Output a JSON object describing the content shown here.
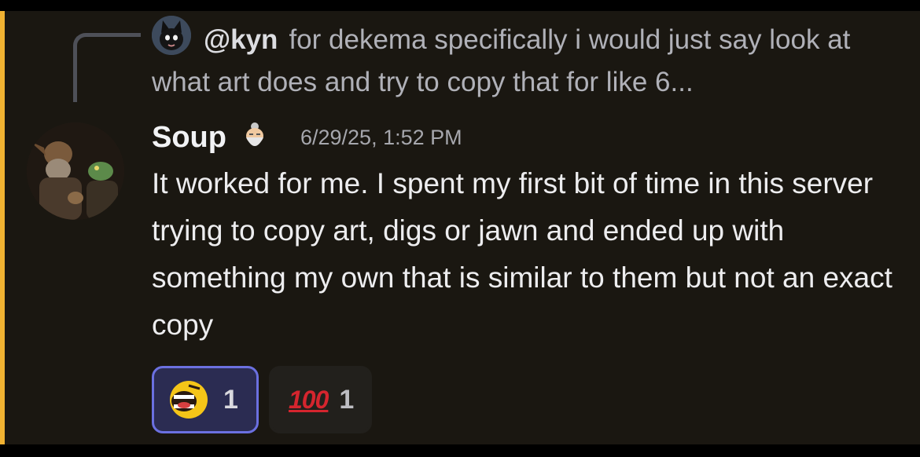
{
  "reply": {
    "author": "@kyn",
    "preview": "for dekema specifically i would just say look at what art does and try to copy that for like 6..."
  },
  "message": {
    "author": "Soup",
    "timestamp": "6/29/25, 1:52 PM",
    "text": "It worked for me. I spent my first bit of time in this server trying to copy art, digs or jawn and ended up with something my own that is similar to them but not an exact copy"
  },
  "reactions": [
    {
      "emoji": "screaming-yellow-face-emoji",
      "count": "1",
      "active": true
    },
    {
      "emoji_text": "100",
      "count": "1",
      "active": false
    }
  ],
  "icons": {
    "reply_avatar": "black-cat-avatar",
    "avatar": "goblin-painting-avatar",
    "role_icon": "old-man-icon"
  },
  "colors": {
    "background": "#1a1711",
    "accent_bar": "#f0b232",
    "reaction_active_border": "#6b70e0",
    "hundred_red": "#d5252e"
  }
}
